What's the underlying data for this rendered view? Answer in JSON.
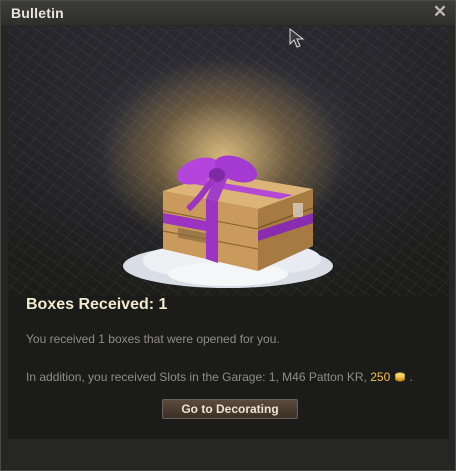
{
  "window": {
    "title": "Bulletin",
    "close_icon": "close-icon"
  },
  "content": {
    "illustration": "gift-box-on-snow",
    "heading": "Boxes Received: 1",
    "message": "You received 1 boxes that were opened for you.",
    "rewards": {
      "prefix": "In addition, you received Slots in the Garage: 1, M46 Patton KR,",
      "gold_amount": "250",
      "gold_icon": "gold-coins-icon",
      "suffix": "."
    },
    "action_button": "Go to Decorating"
  },
  "colors": {
    "ribbon": "#a23fc8",
    "gold": "#f0c040",
    "heading": "#f2ead0",
    "body_text": "#8e8e86"
  }
}
